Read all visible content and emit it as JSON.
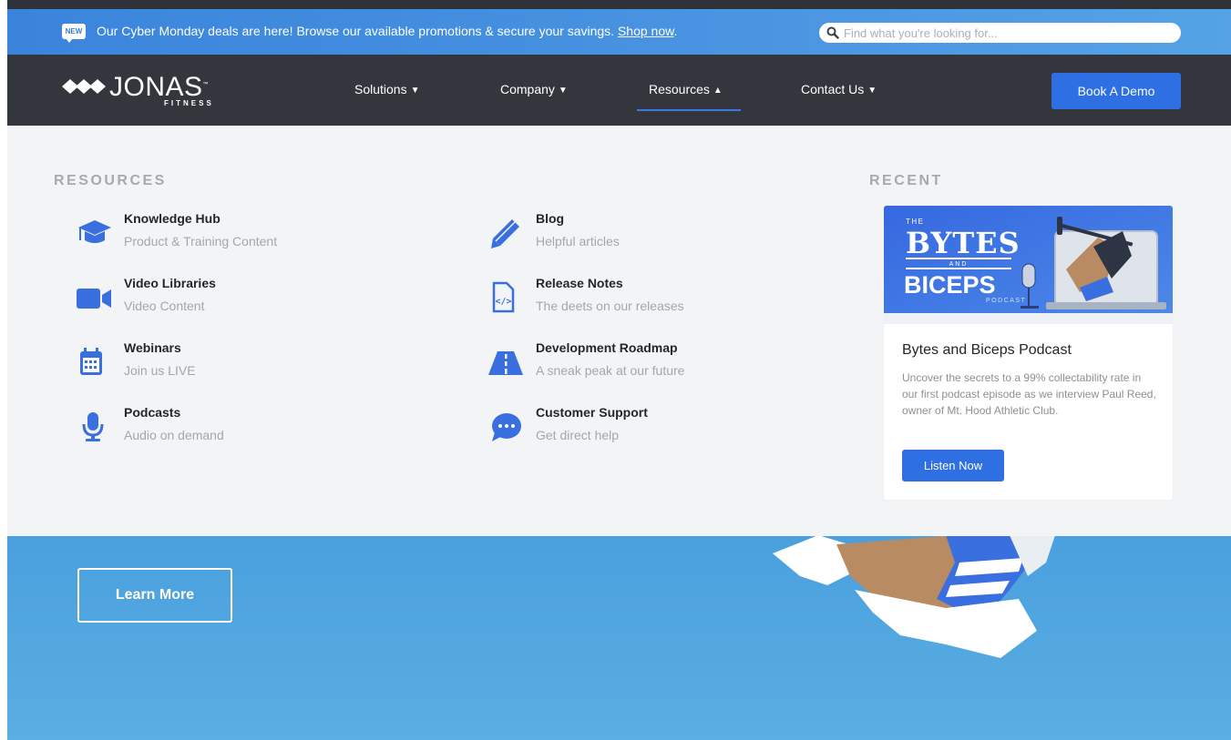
{
  "promo": {
    "badge": "NEW",
    "message": "Our Cyber Monday deals are here! Browse our available promotions & secure your savings.",
    "link": "Shop now",
    "end": "."
  },
  "search": {
    "placeholder": "Find what you're looking for..."
  },
  "logo": {
    "text": "JONAS",
    "tm": "™",
    "subtext": "FITNESS"
  },
  "nav": {
    "items": [
      {
        "label": "Solutions",
        "caret": "▼"
      },
      {
        "label": "Company",
        "caret": "▼"
      },
      {
        "label": "Resources",
        "caret": "▲",
        "active": true
      },
      {
        "label": "Contact Us",
        "caret": "▼"
      }
    ],
    "cta": "Book A Demo"
  },
  "menu": {
    "resources_title": "RESOURCES",
    "recent_title": "RECENT",
    "items": [
      {
        "title": "Knowledge Hub",
        "subtitle": "Product & Training Content",
        "icon": "graduation-cap-icon"
      },
      {
        "title": "Video Libraries",
        "subtitle": "Video Content",
        "icon": "video-camera-icon"
      },
      {
        "title": "Webinars",
        "subtitle": "Join us LIVE",
        "icon": "calendar-icon"
      },
      {
        "title": "Podcasts",
        "subtitle": "Audio on demand",
        "icon": "microphone-icon"
      },
      {
        "title": "Blog",
        "subtitle": "Helpful articles",
        "icon": "pencil-icon"
      },
      {
        "title": "Release Notes",
        "subtitle": "The deets on our releases",
        "icon": "code-file-icon"
      },
      {
        "title": "Development Roadmap",
        "subtitle": "A sneak peak at our future",
        "icon": "road-icon"
      },
      {
        "title": "Customer Support",
        "subtitle": "Get direct help",
        "icon": "chat-bubble-icon"
      }
    ],
    "recent": {
      "image_text": {
        "the": "THE",
        "line1": "BYTES",
        "and": "AND",
        "line2": "BICEPS",
        "podcast": "PODCAST"
      },
      "title": "Bytes and Biceps Podcast",
      "description": "Uncover the secrets to a 99% collectability rate in our first podcast episode as we interview Paul Reed, owner of Mt. Hood Athletic Club.",
      "button": "Listen Now"
    }
  },
  "hero": {
    "button": "Learn More"
  },
  "colors": {
    "accent": "#2f6fe4",
    "nav_bg": "#33363c",
    "panel_bg": "#f3f4f6",
    "hero_bg": "#4aa0de"
  }
}
